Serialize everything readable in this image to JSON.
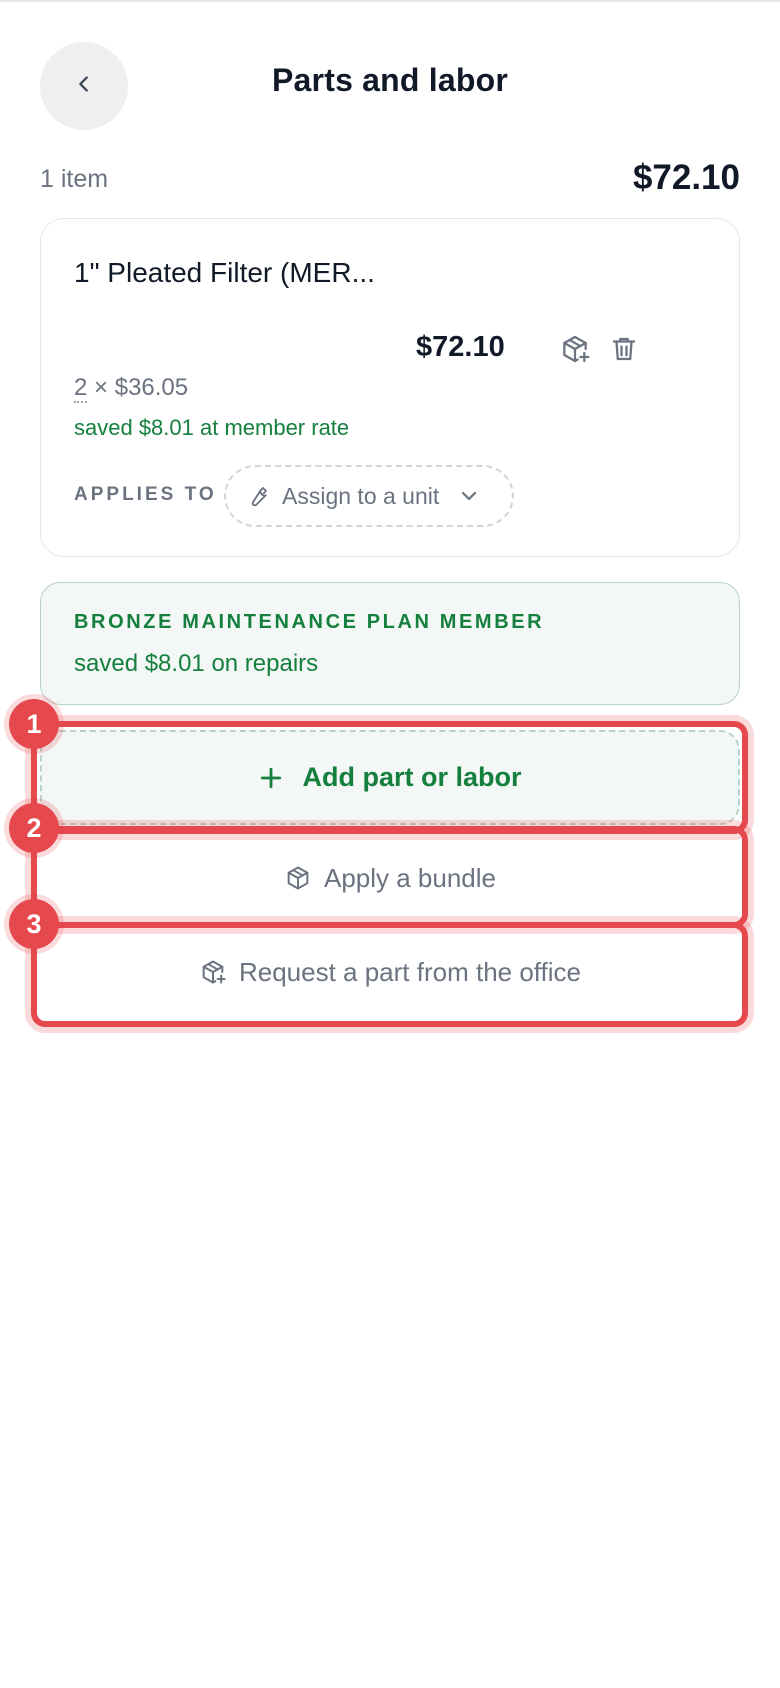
{
  "header": {
    "title": "Parts and labor",
    "back_icon": "chevron-left-icon"
  },
  "summary": {
    "item_count": "1 item",
    "total": "$72.10"
  },
  "item": {
    "name": "1\" Pleated Filter (MER...",
    "price": "$72.10",
    "quantity": "2",
    "unit_price": "× $36.05",
    "savings": "saved $8.01 at member rate",
    "applies_to_label": "APPLIES TO",
    "assign_label": "Assign to a unit"
  },
  "plan": {
    "title": "BRONZE MAINTENANCE PLAN MEMBER",
    "savings": "saved $8.01 on repairs"
  },
  "actions": {
    "add_label": "Add part or labor",
    "bundle_label": "Apply a bundle",
    "request_label": "Request a part from the office"
  },
  "annotations": {
    "one": "1",
    "two": "2",
    "three": "3"
  },
  "colors": {
    "accent_green": "#15803d",
    "highlight_red": "#e5484d",
    "muted_gray": "#6b7280"
  }
}
